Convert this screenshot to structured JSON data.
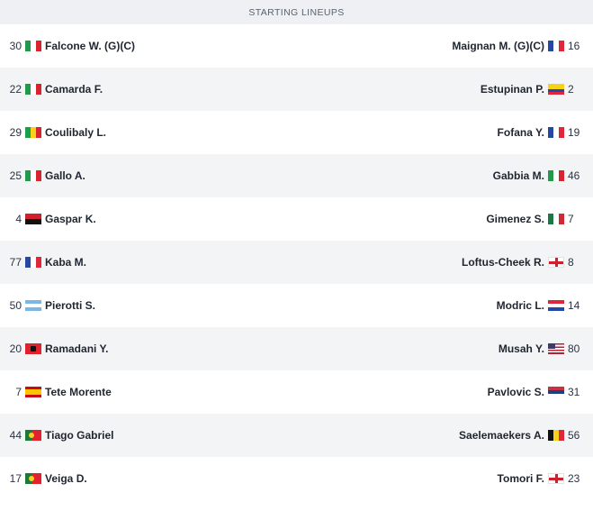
{
  "header": {
    "title": "STARTING LINEUPS"
  },
  "rows": [
    {
      "home": {
        "number": "30",
        "flag": "it",
        "name": "Falcone W. (G)(C)"
      },
      "away": {
        "number": "16",
        "flag": "fr",
        "name": "Maignan M. (G)(C)"
      }
    },
    {
      "home": {
        "number": "22",
        "flag": "it",
        "name": "Camarda F."
      },
      "away": {
        "number": "2",
        "flag": "ec",
        "name": "Estupinan P."
      }
    },
    {
      "home": {
        "number": "29",
        "flag": "ml",
        "name": "Coulibaly L."
      },
      "away": {
        "number": "19",
        "flag": "fr",
        "name": "Fofana Y."
      }
    },
    {
      "home": {
        "number": "25",
        "flag": "it",
        "name": "Gallo A."
      },
      "away": {
        "number": "46",
        "flag": "it",
        "name": "Gabbia M."
      }
    },
    {
      "home": {
        "number": "4",
        "flag": "ao",
        "name": "Gaspar K."
      },
      "away": {
        "number": "7",
        "flag": "mx",
        "name": "Gimenez S."
      }
    },
    {
      "home": {
        "number": "77",
        "flag": "fr",
        "name": "Kaba M."
      },
      "away": {
        "number": "8",
        "flag": "en",
        "name": "Loftus-Cheek R."
      }
    },
    {
      "home": {
        "number": "50",
        "flag": "ar",
        "name": "Pierotti S."
      },
      "away": {
        "number": "14",
        "flag": "hr",
        "name": "Modric L."
      }
    },
    {
      "home": {
        "number": "20",
        "flag": "al",
        "name": "Ramadani Y."
      },
      "away": {
        "number": "80",
        "flag": "us",
        "name": "Musah Y."
      }
    },
    {
      "home": {
        "number": "7",
        "flag": "es",
        "name": "Tete Morente"
      },
      "away": {
        "number": "31",
        "flag": "rs",
        "name": "Pavlovic S."
      }
    },
    {
      "home": {
        "number": "44",
        "flag": "pt",
        "name": "Tiago Gabriel"
      },
      "away": {
        "number": "56",
        "flag": "be",
        "name": "Saelemaekers A."
      }
    },
    {
      "home": {
        "number": "17",
        "flag": "pt",
        "name": "Veiga D."
      },
      "away": {
        "number": "23",
        "flag": "en",
        "name": "Tomori F."
      }
    }
  ]
}
